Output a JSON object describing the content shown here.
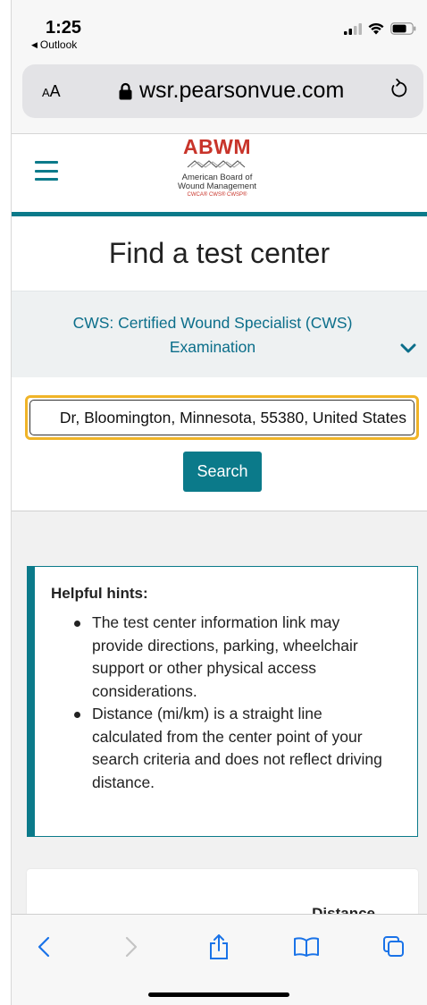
{
  "status_bar": {
    "time": "1:25",
    "back_app": "Outlook"
  },
  "browser": {
    "aa_label_small": "A",
    "aa_label_large": "A",
    "url": "wsr.pearsonvue.com"
  },
  "site": {
    "logo": {
      "abbr": "ABWM",
      "line1": "American Board of",
      "line2": "Wound Management",
      "creds": "CWCA® CWS® CWSP®"
    }
  },
  "page": {
    "title": "Find a test center",
    "exam_selected": "CWS: Certified Wound Specialist (CWS) Examination"
  },
  "search": {
    "value": "Dr, Bloomington, Minnesota, 55380, United States",
    "button_label": "Search"
  },
  "hints": {
    "title": "Helpful hints:",
    "items": [
      "The test center information link may provide directions, parking, wheelchair support or other physical access considerations.",
      "Distance (mi/km) is a straight line calculated from the center point of your search criteria and does not reflect driving distance."
    ]
  },
  "results": {
    "distance_header": "Distance"
  },
  "colors": {
    "accent": "#0b7a8a",
    "link": "#0b6e8a",
    "focus": "#f0b428",
    "logo_red": "#c8342a"
  }
}
